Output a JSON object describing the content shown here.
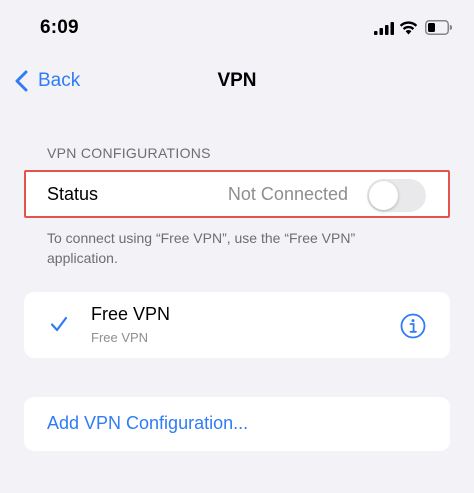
{
  "status_bar": {
    "time": "6:09",
    "icons": [
      "signal-icon",
      "wifi-icon",
      "battery-icon"
    ]
  },
  "nav": {
    "back_label": "Back",
    "title": "VPN"
  },
  "vpn_configurations": {
    "header": "VPN CONFIGURATIONS",
    "status_label": "Status",
    "status_value": "Not Connected",
    "toggle_on": false,
    "footer": "To connect using “Free VPN”, use the “Free VPN” application."
  },
  "vpn_list": [
    {
      "name": "Free VPN",
      "subtitle": "Free VPN",
      "selected": true
    }
  ],
  "add_configuration_label": "Add VPN Configuration...",
  "colors": {
    "accent": "#2f7cf6",
    "background": "#f2f2f7",
    "highlight_border": "#e4544d",
    "secondary_text": "#8e8e93"
  }
}
